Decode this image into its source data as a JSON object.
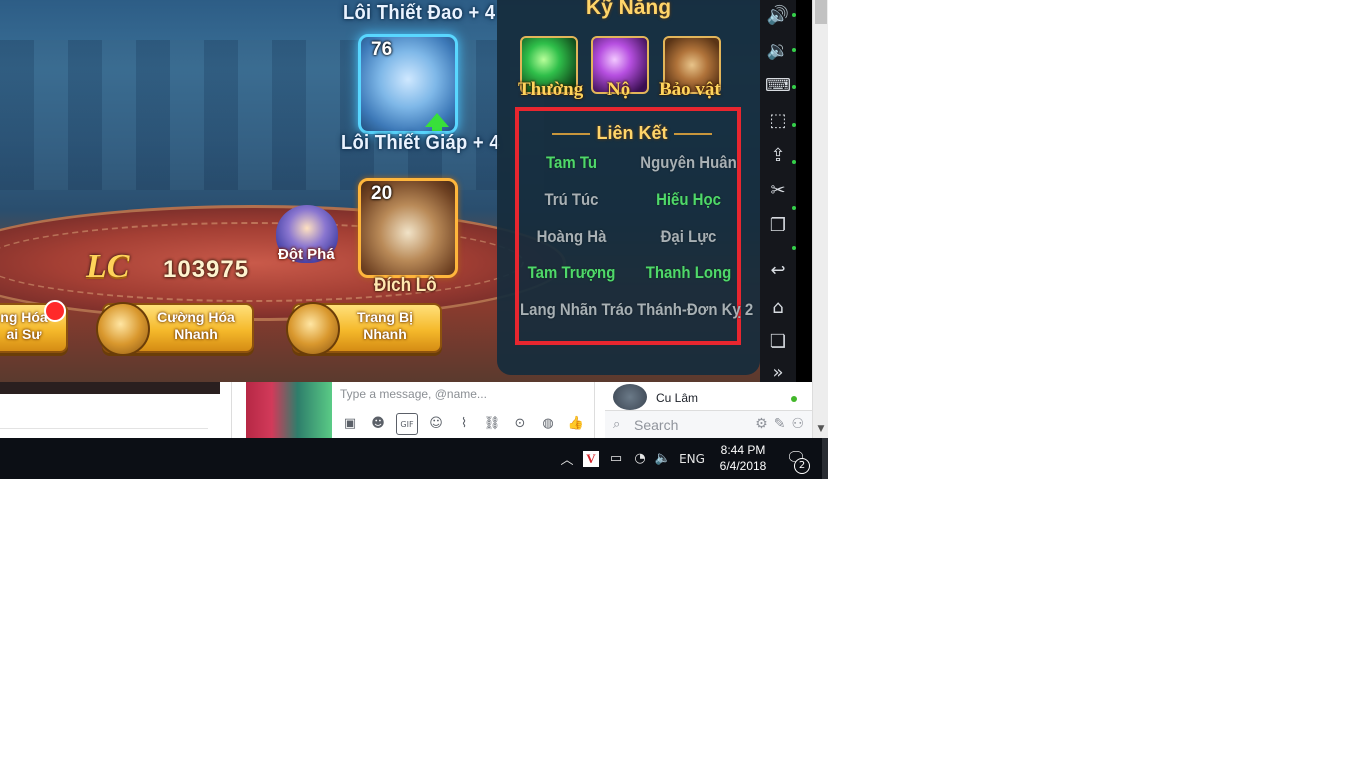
{
  "game": {
    "armor_top_name": "Lôi Thiết Đao + 4",
    "armor_level": "76",
    "armor_name": "Lôi Thiết Giáp + 4",
    "mount_level": "20",
    "mount_name": "Đích Lô",
    "breakthrough_label": "Đột Phá",
    "lc_label": "LC",
    "lc_value": "103975",
    "buttons": [
      {
        "label_line1": "ng Hóa",
        "label_line2": "ai Sư"
      },
      {
        "label_line1": "Cường Hóa",
        "label_line2": "Nhanh"
      },
      {
        "label_line1": "Trang Bị",
        "label_line2": "Nhanh"
      }
    ]
  },
  "skill_panel": {
    "title": "Kỹ Năng",
    "skills": [
      {
        "label": "Thường",
        "icon": "green-spear-icon",
        "color": "#2fbf4a"
      },
      {
        "label": "Nộ",
        "icon": "purple-spear-icon",
        "color": "#b64fe0"
      },
      {
        "label": "Bảo vật",
        "icon": "eye-relic-icon",
        "color": "#b0733a"
      }
    ],
    "links_title": "Liên Kết",
    "links": [
      {
        "name": "Tam Tu",
        "active": true
      },
      {
        "name": "Nguyên Huân",
        "active": false
      },
      {
        "name": "Trú Túc",
        "active": false
      },
      {
        "name": "Hiếu Học",
        "active": true
      },
      {
        "name": "Hoàng Hà",
        "active": false
      },
      {
        "name": "Đại Lực",
        "active": false
      },
      {
        "name": "Tam Trượng",
        "active": true
      },
      {
        "name": "Thanh Long",
        "active": true
      },
      {
        "name": "Lang Nhãn Tráo",
        "active": false
      },
      {
        "name": "Thánh-Đơn Kỵ 2",
        "active": false
      }
    ],
    "highlight_color": "#e8262f"
  },
  "emulator_toolbar": {
    "buttons": [
      {
        "name": "volume-up-icon",
        "glyph": "🔊"
      },
      {
        "name": "volume-down-icon",
        "glyph": "🔉"
      },
      {
        "name": "keyboard-mapping-icon",
        "glyph": "⌨"
      },
      {
        "name": "screen-record-icon",
        "glyph": "⬚"
      },
      {
        "name": "apk-install-icon",
        "glyph": "⇪"
      },
      {
        "name": "scissors-icon",
        "glyph": "✂"
      },
      {
        "name": "multi-window-icon",
        "glyph": "❐"
      },
      {
        "name": "back-icon",
        "glyph": "↩"
      },
      {
        "name": "home-icon",
        "glyph": "⌂"
      },
      {
        "name": "recent-apps-icon",
        "glyph": "❏"
      },
      {
        "name": "expand-icon",
        "glyph": "»"
      }
    ]
  },
  "chat": {
    "message_placeholder": "Type a message, @name...",
    "icons": [
      "image-icon",
      "sticker-icon",
      "gif-icon",
      "emoji-icon",
      "attach-icon",
      "link-icon",
      "camera-icon",
      "poll-icon",
      "like-icon"
    ]
  },
  "contacts": {
    "contact_name": "Cu Lâm",
    "search_placeholder": "Search"
  },
  "taskbar": {
    "language": "ENG",
    "time": "8:44 PM",
    "date": "6/4/2018",
    "notification_count": "2"
  }
}
